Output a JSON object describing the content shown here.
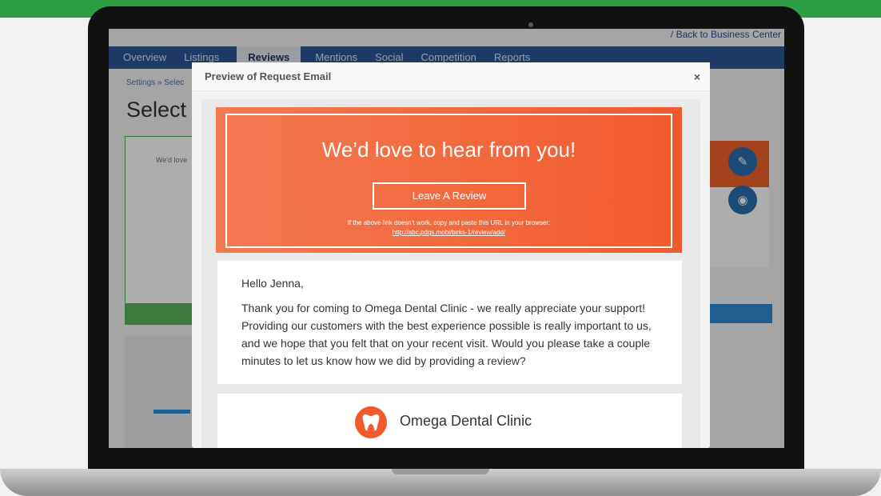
{
  "app": {
    "top_link": "/ Back to Business Center",
    "nav": [
      "Overview",
      "Listings",
      "Reviews",
      "Mentions",
      "Social",
      "Competition",
      "Reports"
    ],
    "active_nav": "Reviews",
    "breadcrumb": "Settings  »  Selec",
    "page_title": "Select",
    "card_left_text": "We'd love"
  },
  "modal": {
    "title": "Preview of Request Email",
    "close_label": "×",
    "banner": {
      "heading": "We’d love to hear from you!",
      "button_label": "Leave A Review",
      "note": "If the above link doesn’t work, copy and paste this URL in your browser:",
      "url": "http://abc.pdqs.mobi/birks-1/review/add/"
    },
    "message": {
      "greeting": "Hello Jenna,",
      "body": "Thank you for coming to Omega Dental Clinic - we really appreciate your support! Providing our customers with the best experience possible is really important to us, and we hope that you felt that on your recent visit. Would you please take a couple minutes to let us know how we did by providing a review?"
    },
    "clinic": {
      "name": "Omega Dental Clinic"
    }
  },
  "colors": {
    "brand_orange": "#f15a2d",
    "nav_blue": "#2f5795",
    "accent_green": "#2e9e43"
  }
}
